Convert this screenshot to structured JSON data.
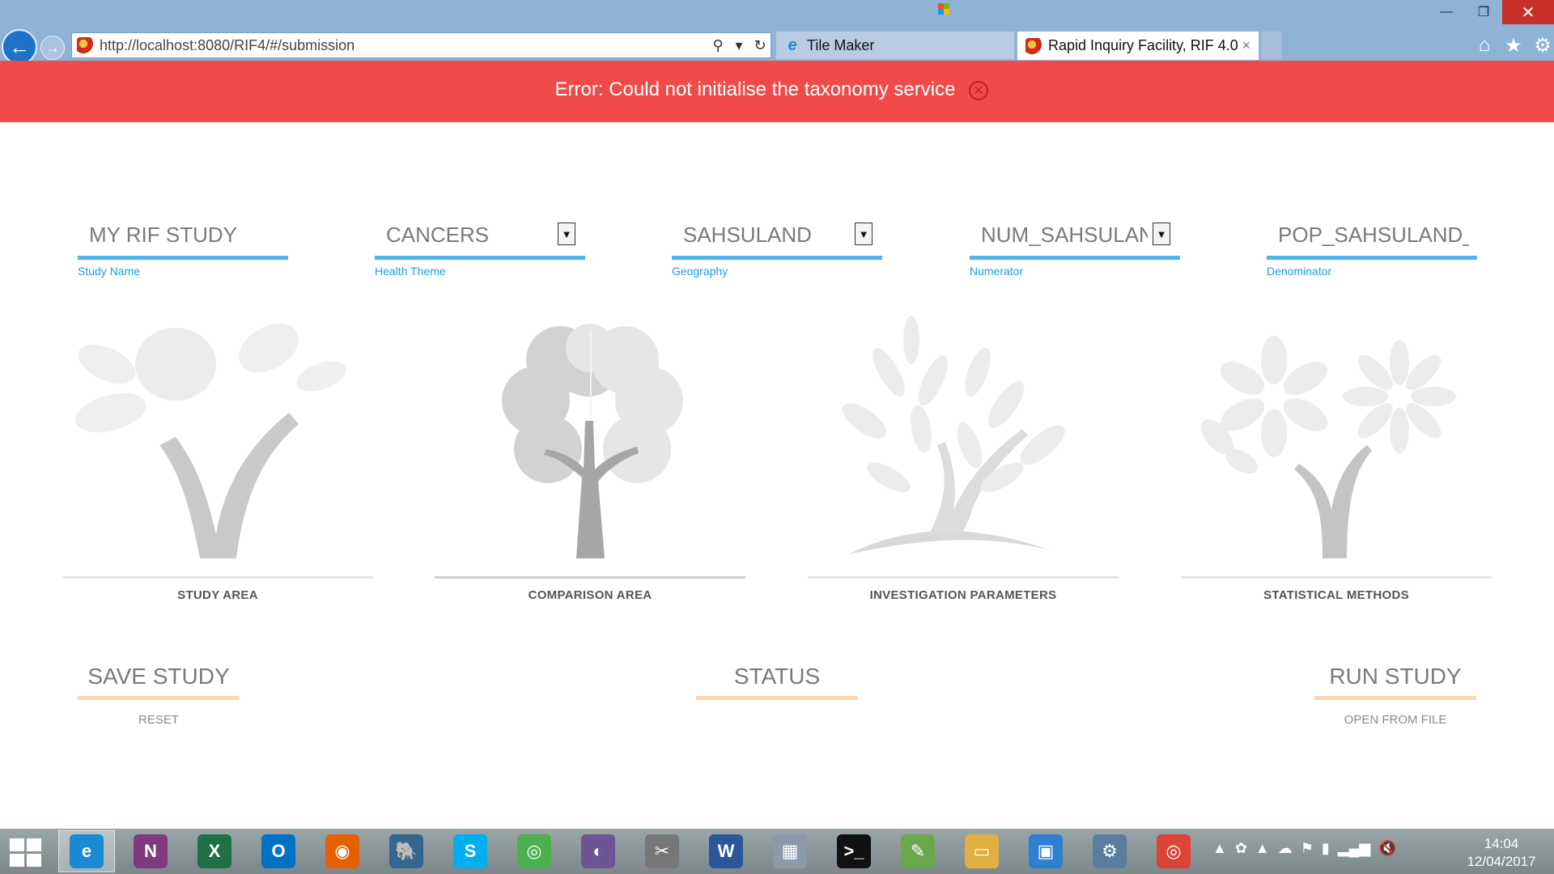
{
  "window": {
    "minimize": "—",
    "restore": "❐",
    "close": "✕"
  },
  "browser": {
    "url": "http://localhost:8080/RIF4/#/submission",
    "tabs": [
      {
        "label": "Tile Maker",
        "icon": "ie-icon"
      },
      {
        "label": "Rapid Inquiry Facility, RIF 4.0",
        "icon": "rif-icon",
        "close": "×"
      }
    ],
    "search_glyph": "⚲",
    "dropdown_glyph": "▾",
    "refresh_glyph": "↻",
    "home_glyph": "⌂",
    "favorites_glyph": "★",
    "settings_glyph": "⚙",
    "back_glyph": "←",
    "forward_glyph": "→"
  },
  "error": {
    "message": "Error: Could not initialise the taxonomy service",
    "close_glyph": "✕"
  },
  "fields": {
    "study_name": {
      "value": "MY RIF STUDY",
      "label": "Study Name"
    },
    "health_theme": {
      "value": "CANCERS",
      "label": "Health Theme"
    },
    "geography": {
      "value": "SAHSULAND",
      "label": "Geography"
    },
    "numerator": {
      "value": "NUM_SAHSULAND_CANCER",
      "label": "Numerator"
    },
    "denominator": {
      "value": "POP_SAHSULAND_POP",
      "label": "Denominator"
    },
    "dropdown_glyph": "▼"
  },
  "cards": {
    "study_area": "STUDY AREA",
    "comparison_area": "COMPARISON AREA",
    "investigation_parameters": "INVESTIGATION PARAMETERS",
    "statistical_methods": "STATISTICAL METHODS"
  },
  "actions": {
    "save": "SAVE STUDY",
    "reset": "RESET",
    "status": "STATUS",
    "run": "RUN STUDY",
    "open": "OPEN FROM FILE"
  },
  "taskbar": {
    "apps": [
      {
        "name": "internet-explorer",
        "glyph": "e",
        "color": "#1a8ad4"
      },
      {
        "name": "onenote",
        "glyph": "N",
        "color": "#80397b"
      },
      {
        "name": "excel",
        "glyph": "X",
        "color": "#1e7145"
      },
      {
        "name": "outlook",
        "glyph": "O",
        "color": "#0072c6"
      },
      {
        "name": "firefox",
        "glyph": "◉",
        "color": "#e66000"
      },
      {
        "name": "postgresql",
        "glyph": "🐘",
        "color": "#336791"
      },
      {
        "name": "skype",
        "glyph": "S",
        "color": "#00aff0"
      },
      {
        "name": "chrome",
        "glyph": "◎",
        "color": "#4caf50"
      },
      {
        "name": "github",
        "glyph": "◐",
        "color": "#6e5494"
      },
      {
        "name": "tools",
        "glyph": "✂",
        "color": "#777777"
      },
      {
        "name": "word",
        "glyph": "W",
        "color": "#2b579a"
      },
      {
        "name": "calculator",
        "glyph": "▦",
        "color": "#8a9aa8"
      },
      {
        "name": "command-prompt",
        "glyph": ">_",
        "color": "#111111"
      },
      {
        "name": "notepad",
        "glyph": "✎",
        "color": "#6aa84f"
      },
      {
        "name": "file-explorer",
        "glyph": "▭",
        "color": "#e0b040"
      },
      {
        "name": "remote-desktop",
        "glyph": "▣",
        "color": "#2f7fd0"
      },
      {
        "name": "settings",
        "glyph": "⚙",
        "color": "#5b7e9e"
      },
      {
        "name": "chrome-2",
        "glyph": "◎",
        "color": "#db4437"
      }
    ],
    "tray": [
      "▲",
      "✿",
      "▲",
      "☁",
      "⚑",
      "▮",
      "▂▄▆",
      "🔇"
    ],
    "time": "14:04",
    "date": "12/04/2017"
  }
}
